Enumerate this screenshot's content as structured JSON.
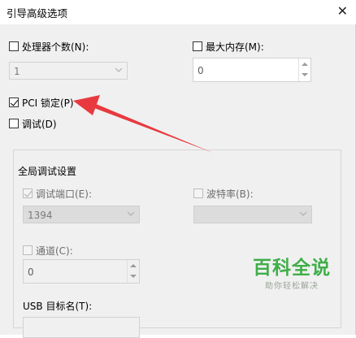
{
  "window": {
    "title": "引导高级选项"
  },
  "processors": {
    "label": "处理器个数(N):",
    "checked": false,
    "value": "1"
  },
  "max_memory": {
    "label": "最大内存(M):",
    "checked": false,
    "value": "0"
  },
  "pci_lock": {
    "label": "PCI 锁定(P)",
    "checked": true
  },
  "debug": {
    "label": "调试(D)",
    "checked": false
  },
  "global_debug": {
    "group_label": "全局调试设置",
    "debug_port": {
      "label": "调试端口(E):",
      "checked": true,
      "value": "1394"
    },
    "baud_rate": {
      "label": "波特率(B):",
      "checked": false,
      "value": ""
    },
    "channel": {
      "label": "通道(C):",
      "checked": false,
      "value": "0"
    },
    "usb_target_label": "USB 目标名(T):"
  },
  "watermark": {
    "main": "百科全说",
    "sub": "助你轻松解决"
  },
  "annotation": {
    "arrow_color": "#e8393f"
  }
}
